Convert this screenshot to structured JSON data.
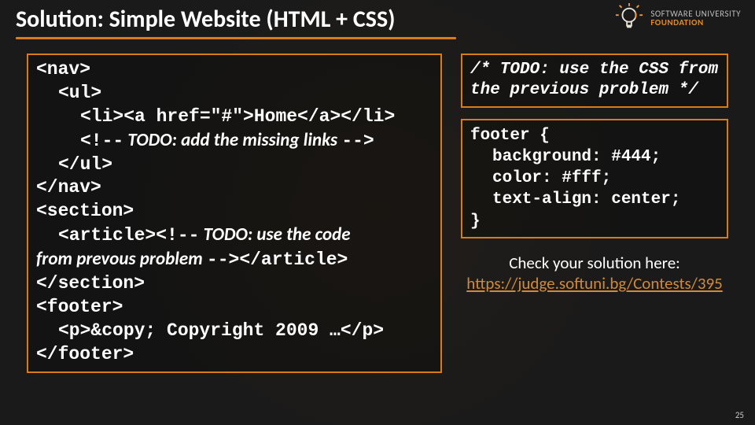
{
  "header": {
    "title": "Solution: Simple Website (HTML + CSS)"
  },
  "logo": {
    "line1": "SOFTWARE UNIVERSITY",
    "line2": "FOUNDATION",
    "icon": "lightbulb-icon"
  },
  "code_left": {
    "l1": "<nav>",
    "l2": "<ul>",
    "l3": "<li><a href=\"#\">Home</a></li>",
    "l4a": "<!--",
    "l4b": " TODO: add the missing links ",
    "l4c": "-->",
    "l5": "</ul>",
    "l6": "</nav>",
    "l7": "<section>",
    "l8a": "<article>",
    "l8b": "<!--",
    "l8c": " TODO: use the code",
    "l9a": "from prevous problem ",
    "l9b": "-->",
    "l9c": "</article>",
    "l10": "</section>",
    "l11": "<footer>",
    "l12": "<p>&copy; Copyright 2009 …</p>",
    "l13": "</footer>"
  },
  "code_right1": {
    "line1": "/*  TODO: use the CSS from",
    "line2": "the previous problem */"
  },
  "code_right2": {
    "l1": "footer {",
    "l2": "background: #444;",
    "l3": "color: #fff;",
    "l4": "text-align: center;",
    "l5": "}"
  },
  "check": {
    "label": "Check your solution here:",
    "link": "https://judge.softuni.bg/Contests/395"
  },
  "page_number": "25"
}
